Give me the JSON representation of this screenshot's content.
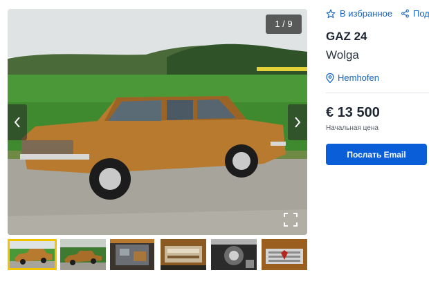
{
  "gallery": {
    "counter": "1 / 9",
    "prev_icon": "chevron-left-icon",
    "next_icon": "chevron-right-icon",
    "expand_icon": "expand-icon",
    "photo_colors": {
      "sky": "#dfe3e4",
      "field": "#3f8a2e",
      "road": "#a7a49b",
      "car": "#b87a2e"
    },
    "thumbnail_count": 6,
    "active_thumbnail": 1
  },
  "actions": {
    "favorite_label": "В избранное",
    "favorite_icon": "star-outline-icon",
    "share_label": "Под",
    "share_icon": "share-icon"
  },
  "listing": {
    "title": "GAZ 24",
    "subtitle": "Wolga",
    "location": "Hemhofen",
    "location_icon": "map-pin-icon",
    "price": "€ 13 500",
    "price_label": "Начальная цена",
    "email_button": "Послать Email"
  },
  "colors": {
    "accent": "#0a5fd8",
    "link": "#1565c0",
    "highlight": "#f2c300"
  }
}
